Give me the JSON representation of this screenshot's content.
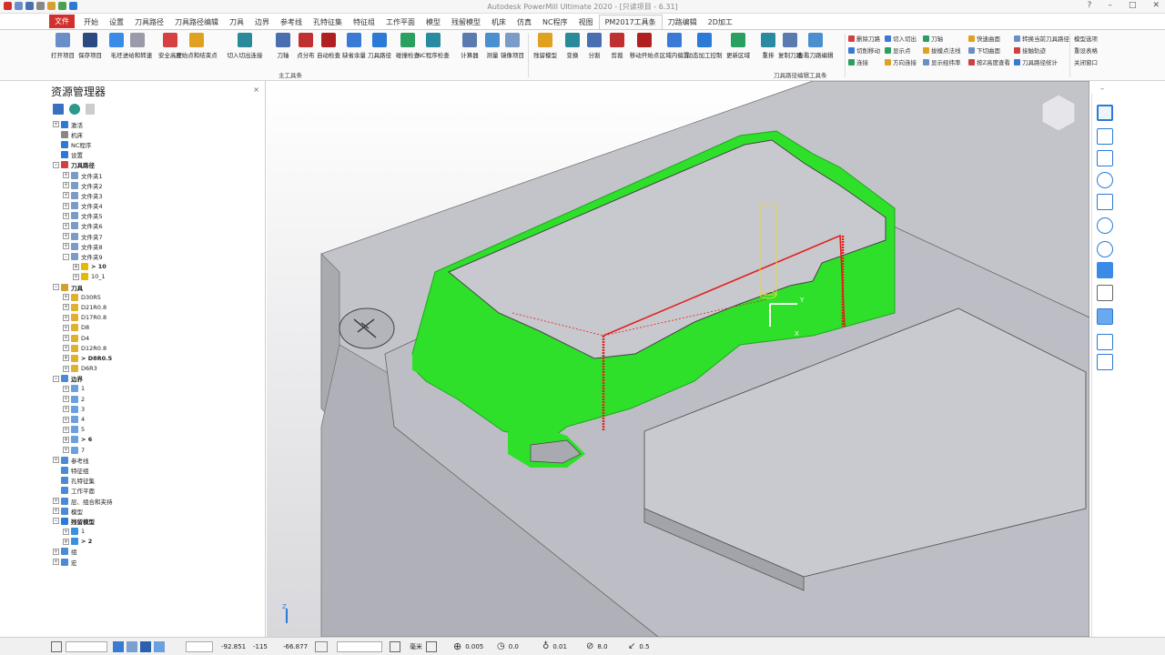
{
  "window": {
    "title": "Autodesk PowerMill Ultimate 2020 - [只读项目 - 6.31]",
    "help_glyph": "?"
  },
  "colors": {
    "file_tab": "#d0312d",
    "stock_green": "#2fe02a",
    "toolpath_red": "#e0221a",
    "tool_yellow": "#e8d44a",
    "model_grey": "#b9b9c0"
  },
  "tabs": {
    "file": "文件",
    "items": [
      "开始",
      "设置",
      "刀具路径",
      "刀具路径编辑",
      "刀具",
      "边界",
      "参考线",
      "孔特征集",
      "特征组",
      "工作平面",
      "模型",
      "残留模型",
      "机床",
      "仿真",
      "NC程序",
      "视图",
      "PM2017工具条",
      "刀路编辑",
      "2D加工"
    ],
    "active": "PM2017工具条"
  },
  "ribbon": {
    "main_buttons": [
      "打开项目",
      "保存项目",
      "毛坯",
      "进给和转速",
      "安全高度",
      "开始点和结束点",
      "切入切出连接",
      "刀轴",
      "点分布",
      "自动检查",
      "缺省余量",
      "刀具路径",
      "碰撞检查",
      "NC程序检查",
      "计算器",
      "测量",
      "镜像项目"
    ],
    "main_group_label": "主工具条",
    "edit_buttons": [
      "残留模型",
      "变换",
      "分割",
      "剪裁",
      "移动开始点",
      "区域内偏置",
      "动态加工控制",
      "更新区域",
      "重排",
      "复制刀路",
      "查看刀路编辑"
    ],
    "edit_group_label": "刀具路径编辑工具条",
    "small_col1": [
      "删除刀路",
      "切削移动",
      "连接"
    ],
    "small_col2": [
      "切入切出",
      "显示点",
      "方向连接"
    ],
    "small_col3": [
      "刀轴",
      "拔模点法线",
      "显示经纬率"
    ],
    "small_col4": [
      "快速曲面",
      "下切曲面",
      "按Z高度查看"
    ],
    "small_col5": [
      "转换当前刀具路径",
      "接触轨迹",
      "刀具路径统计"
    ],
    "right_col": [
      "模型选项",
      "重设表格",
      "关闭窗口"
    ]
  },
  "explorer": {
    "title": "资源管理器",
    "close": "×",
    "tree": [
      {
        "label": "激活",
        "level": 0,
        "bold": false,
        "expander": "+",
        "icon": "#2a7ad6"
      },
      {
        "label": "机床",
        "level": 0,
        "bold": false,
        "expander": "",
        "icon": "#888888"
      },
      {
        "label": "NC程序",
        "level": 0,
        "bold": false,
        "expander": "",
        "icon": "#2a7ad6"
      },
      {
        "label": "设置",
        "level": 0,
        "bold": false,
        "expander": "",
        "icon": "#2a7ad6"
      },
      {
        "label": "刀具路径",
        "level": 0,
        "bold": true,
        "expander": "-",
        "icon": "#d04040"
      },
      {
        "label": "文件夹1",
        "level": 1,
        "bold": false,
        "expander": "+",
        "icon": "#7a9cc6"
      },
      {
        "label": "文件夹2",
        "level": 1,
        "bold": false,
        "expander": "+",
        "icon": "#7a9cc6"
      },
      {
        "label": "文件夹3",
        "level": 1,
        "bold": false,
        "expander": "+",
        "icon": "#7a9cc6"
      },
      {
        "label": "文件夹4",
        "level": 1,
        "bold": false,
        "expander": "+",
        "icon": "#7a9cc6"
      },
      {
        "label": "文件夹5",
        "level": 1,
        "bold": false,
        "expander": "+",
        "icon": "#7a9cc6"
      },
      {
        "label": "文件夹6",
        "level": 1,
        "bold": false,
        "expander": "+",
        "icon": "#7a9cc6"
      },
      {
        "label": "文件夹7",
        "level": 1,
        "bold": false,
        "expander": "+",
        "icon": "#7a9cc6"
      },
      {
        "label": "文件夹8",
        "level": 1,
        "bold": false,
        "expander": "+",
        "icon": "#7a9cc6"
      },
      {
        "label": "文件夹9",
        "level": 1,
        "bold": false,
        "expander": "-",
        "icon": "#7a9cc6"
      },
      {
        "label": "> 10",
        "level": 2,
        "bold": true,
        "expander": "+",
        "icon": "#e8b800"
      },
      {
        "label": "10_1",
        "level": 2,
        "bold": false,
        "expander": "+",
        "icon": "#e8b800"
      },
      {
        "label": "刀具",
        "level": 0,
        "bold": true,
        "expander": "-",
        "icon": "#d0a030"
      },
      {
        "label": "D30R5",
        "level": 1,
        "bold": false,
        "expander": "+",
        "icon": "#e0b030"
      },
      {
        "label": "D21R0.8",
        "level": 1,
        "bold": false,
        "expander": "+",
        "icon": "#e0b030"
      },
      {
        "label": "D17R0.8",
        "level": 1,
        "bold": false,
        "expander": "+",
        "icon": "#e0b030"
      },
      {
        "label": "D8",
        "level": 1,
        "bold": false,
        "expander": "+",
        "icon": "#e0b030"
      },
      {
        "label": "D4",
        "level": 1,
        "bold": false,
        "expander": "+",
        "icon": "#e0b030"
      },
      {
        "label": "D12R0.8",
        "level": 1,
        "bold": false,
        "expander": "+",
        "icon": "#e0b030"
      },
      {
        "label": "> D8R0.5",
        "level": 1,
        "bold": true,
        "expander": "+",
        "icon": "#e0b030"
      },
      {
        "label": "D6R3",
        "level": 1,
        "bold": false,
        "expander": "+",
        "icon": "#e0b030"
      },
      {
        "label": "边界",
        "level": 0,
        "bold": true,
        "expander": "-",
        "icon": "#4a8ad6"
      },
      {
        "label": "1",
        "level": 1,
        "bold": false,
        "expander": "+",
        "icon": "#6aa0e0"
      },
      {
        "label": "2",
        "level": 1,
        "bold": false,
        "expander": "+",
        "icon": "#6aa0e0"
      },
      {
        "label": "3",
        "level": 1,
        "bold": false,
        "expander": "+",
        "icon": "#6aa0e0"
      },
      {
        "label": "4",
        "level": 1,
        "bold": false,
        "expander": "+",
        "icon": "#6aa0e0"
      },
      {
        "label": "5",
        "level": 1,
        "bold": false,
        "expander": "+",
        "icon": "#6aa0e0"
      },
      {
        "label": "> 6",
        "level": 1,
        "bold": true,
        "expander": "+",
        "icon": "#6aa0e0"
      },
      {
        "label": "7",
        "level": 1,
        "bold": false,
        "expander": "+",
        "icon": "#6aa0e0"
      },
      {
        "label": "参考线",
        "level": 0,
        "bold": false,
        "expander": "+",
        "icon": "#4a8ad6"
      },
      {
        "label": "特征组",
        "level": 0,
        "bold": false,
        "expander": "",
        "icon": "#4a8ad6"
      },
      {
        "label": "孔特征集",
        "level": 0,
        "bold": false,
        "expander": "",
        "icon": "#4a8ad6"
      },
      {
        "label": "工作平面",
        "level": 0,
        "bold": false,
        "expander": "",
        "icon": "#4a8ad6"
      },
      {
        "label": "层、组合和夹持",
        "level": 0,
        "bold": false,
        "expander": "+",
        "icon": "#4a8ad6"
      },
      {
        "label": "模型",
        "level": 0,
        "bold": false,
        "expander": "+",
        "icon": "#4a8ad6"
      },
      {
        "label": "残留模型",
        "level": 0,
        "bold": true,
        "expander": "-",
        "icon": "#2a7ad6"
      },
      {
        "label": "1",
        "level": 1,
        "bold": false,
        "expander": "+",
        "icon": "#3a90e0"
      },
      {
        "label": "> 2",
        "level": 1,
        "bold": true,
        "expander": "+",
        "icon": "#3a90e0"
      },
      {
        "label": "组",
        "level": 0,
        "bold": false,
        "expander": "+",
        "icon": "#4a8ad6"
      },
      {
        "label": "宏",
        "level": 0,
        "bold": false,
        "expander": "+",
        "icon": "#4a8ad6"
      }
    ]
  },
  "viewport": {
    "axis_x": "X",
    "axis_y": "Y",
    "axis_z": "Z",
    "minimize": "–"
  },
  "status": {
    "coord_x": "-92.851",
    "coord_y": "-115",
    "coord_z": "-66.877",
    "unit": "毫米",
    "tolerance": "0.005",
    "thickness": "0.0",
    "tool_offset": "0.01",
    "feed": "8.0",
    "step": "0.5"
  }
}
